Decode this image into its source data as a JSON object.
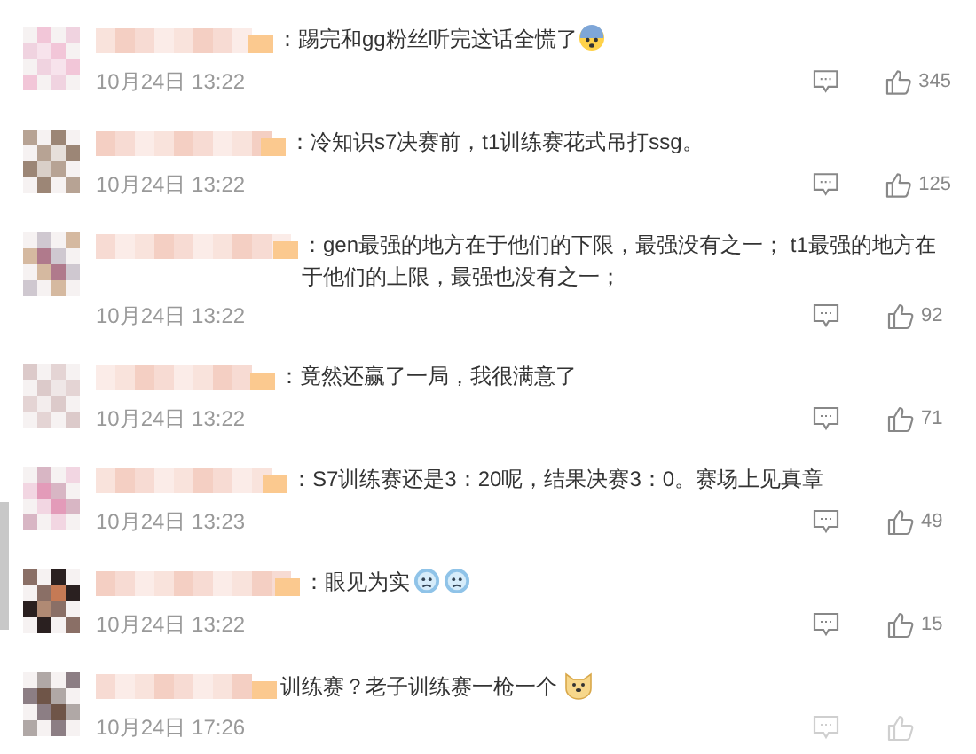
{
  "comments": [
    {
      "text": "：踢完和gg粉丝听完这话全慌了",
      "emojis": [
        {
          "kind": "scared"
        }
      ],
      "date": "10月24日 13:22",
      "likes": "345"
    },
    {
      "text": "：冷知识s7决赛前，t1训练赛花式吊打ssg。",
      "date": "10月24日 13:22",
      "likes": "125"
    },
    {
      "text": "：gen最强的地方在于他们的下限，最强没有之一； t1最强的地方在于他们的上限，最强也没有之一；",
      "date": "10月24日 13:22",
      "likes": "92"
    },
    {
      "text": "：竟然还赢了一局，我很满意了",
      "date": "10月24日 13:22",
      "likes": "71"
    },
    {
      "text": "：S7训练赛还是3：20呢，结果决赛3：0。赛场上见真章",
      "date": "10月24日 13:23",
      "likes": "49"
    },
    {
      "text": "：眼见为实",
      "emojis": [
        {
          "kind": "sad"
        },
        {
          "kind": "sad"
        }
      ],
      "date": "10月24日 13:22",
      "likes": "15"
    },
    {
      "text": "训练赛？老子训练赛一枪一个",
      "emojis": [
        {
          "kind": "doge"
        }
      ],
      "date": "10月24日 17:26"
    }
  ]
}
